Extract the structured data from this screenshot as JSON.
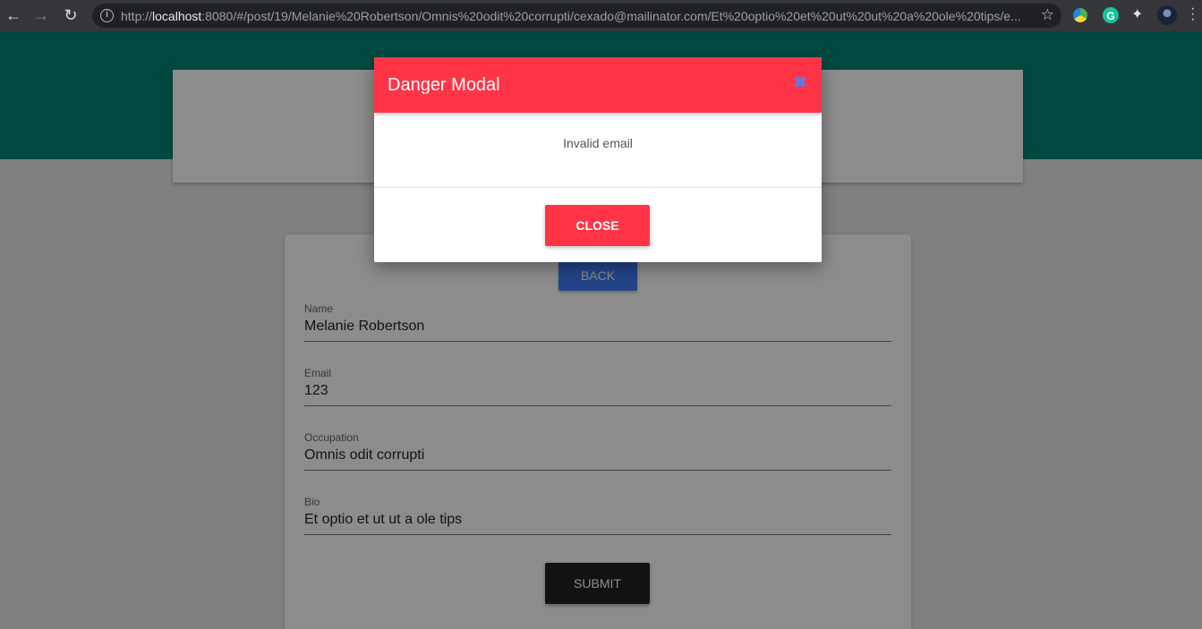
{
  "browser": {
    "url_prefix": "http://",
    "url_host": "localhost",
    "url_rest": ":8080/#/post/19/Melanie%20Robertson/Omnis%20odit%20corrupti/cexado@mailinator.com/Et%20optio%20et%20ut%20ut%20a%20ole%20tips/e..."
  },
  "form": {
    "back_label": "BACK",
    "fields": [
      {
        "label": "Name",
        "value": "Melanie Robertson"
      },
      {
        "label": "Email",
        "value": "123"
      },
      {
        "label": "Occupation",
        "value": "Omnis odit corrupti"
      },
      {
        "label": "Bio",
        "value": "Et optio et ut ut a ole tips"
      }
    ],
    "submit_label": "SUBMIT"
  },
  "modal": {
    "title": "Danger Modal",
    "message": "Invalid email",
    "close_label": "CLOSE",
    "header_color": "#ff3547"
  },
  "colors": {
    "hero": "#008577",
    "back_button": "#3f7cf4",
    "submit_button": "#212121"
  }
}
